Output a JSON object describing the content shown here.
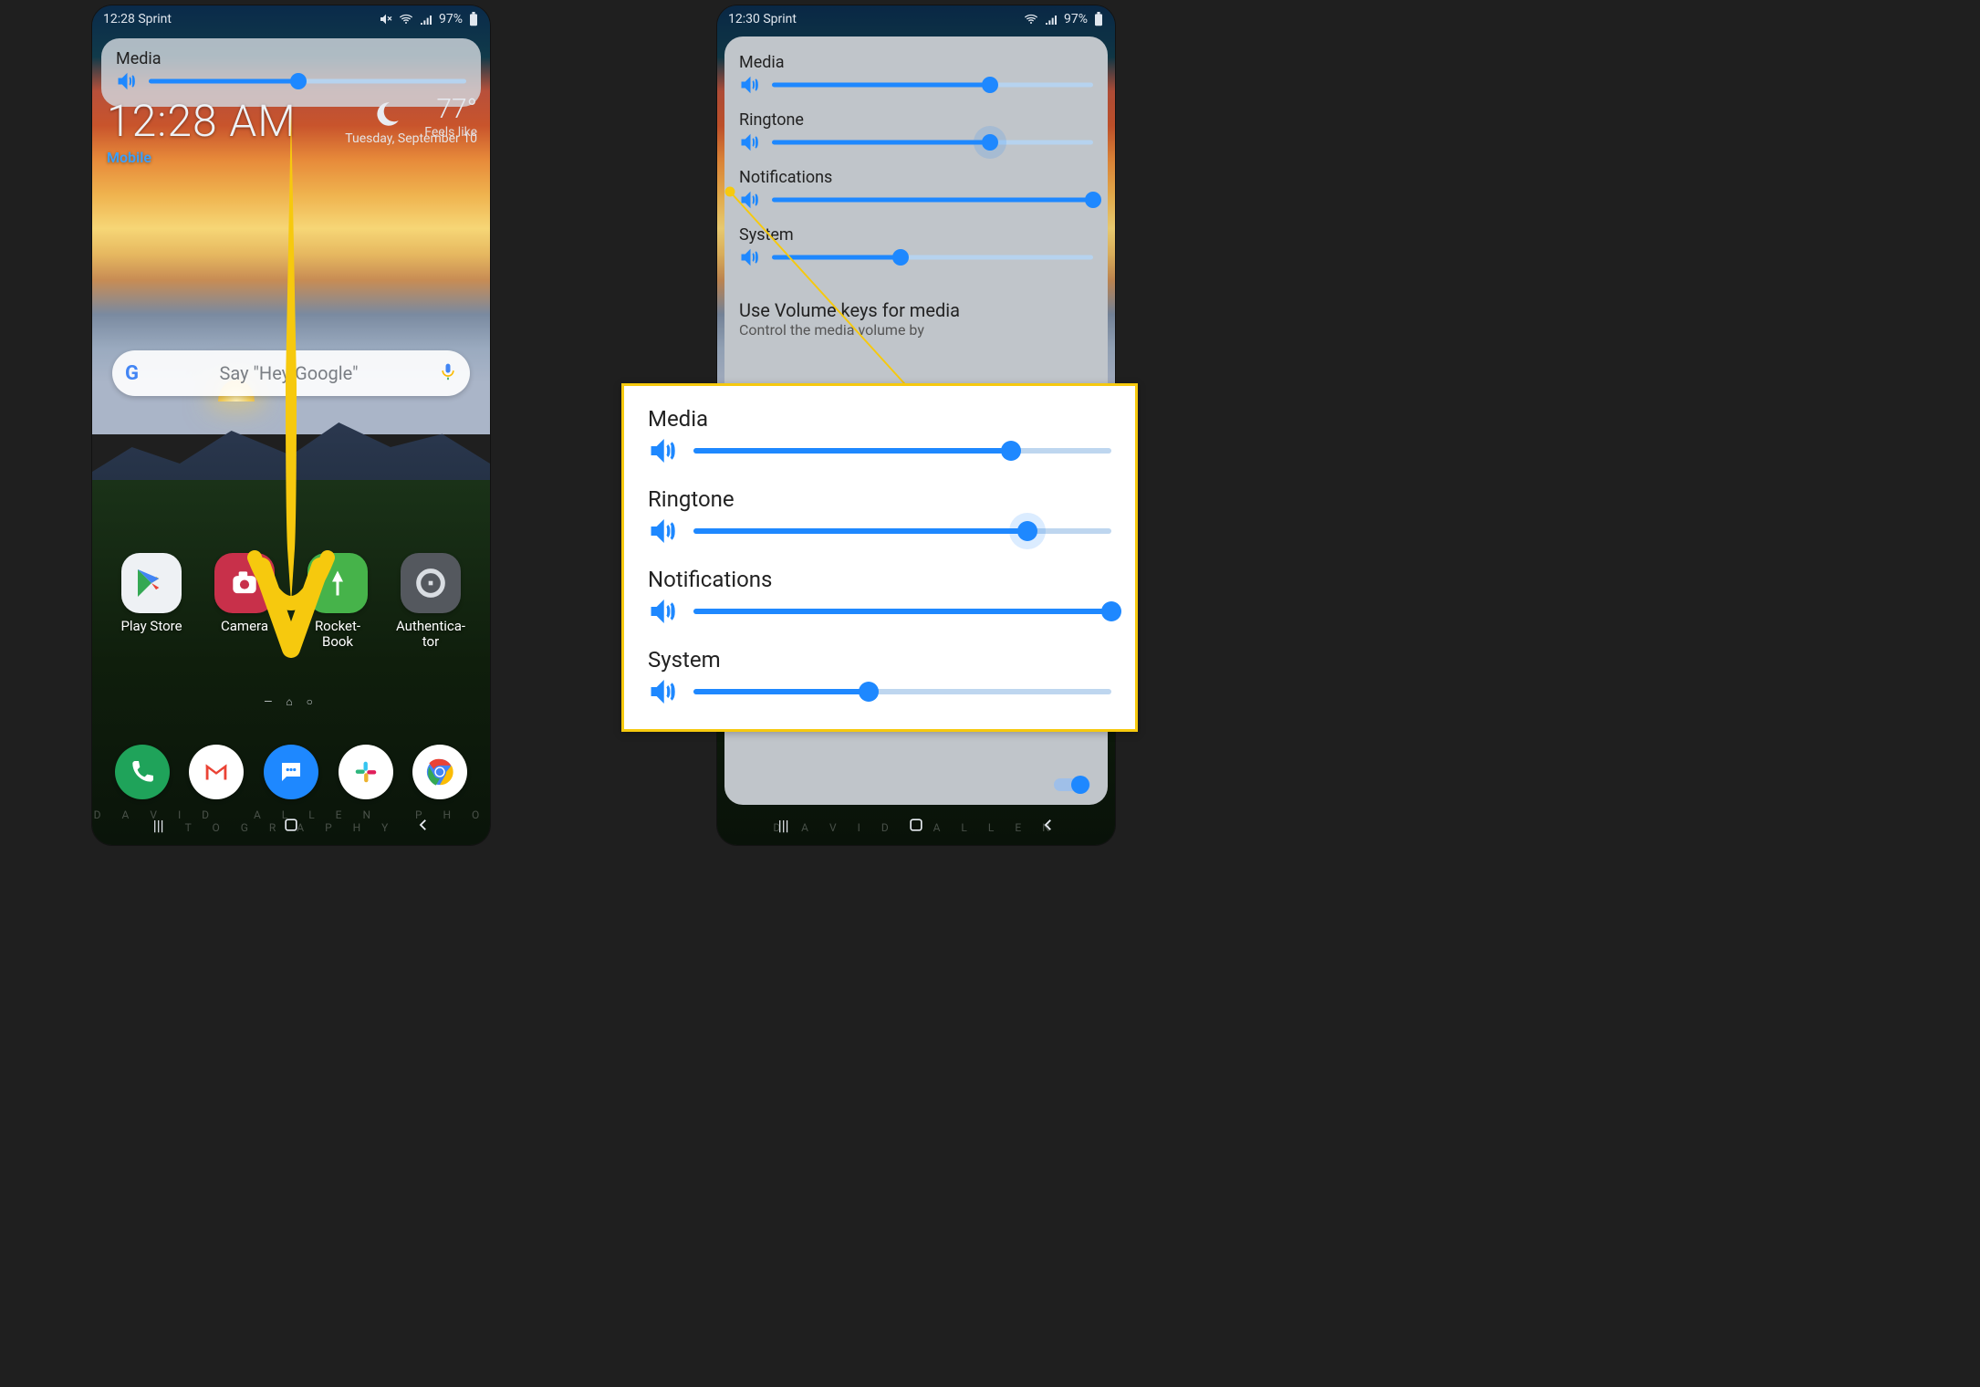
{
  "status_left": {
    "time": "12:28",
    "carrier": "Sprint",
    "battery": "97%"
  },
  "status_right": {
    "time": "12:30",
    "carrier": "Sprint",
    "battery": "97%"
  },
  "home": {
    "clock": "12:28 AM",
    "mobile": "Mobile",
    "date": "Tuesday, September 10",
    "temp": "77",
    "feels": "Feels like",
    "search_hint": "Say \"Hey Google\"",
    "apps": [
      {
        "label": "Play Store"
      },
      {
        "label": "Camera"
      },
      {
        "label": "Rocket-\nBook"
      },
      {
        "label": "Authentica-\ntor"
      }
    ]
  },
  "overlay": {
    "media_label": "Media",
    "media_pct": 47
  },
  "panel": {
    "items": [
      {
        "label": "Media",
        "pct": 68,
        "halo": false
      },
      {
        "label": "Ringtone",
        "pct": 68,
        "halo": true
      },
      {
        "label": "Notifications",
        "pct": 100,
        "halo": false
      },
      {
        "label": "System",
        "pct": 40,
        "halo": false
      }
    ],
    "option_title": "Use Volume keys for media",
    "option_sub": "Control the media volume by"
  },
  "zoom": {
    "items": [
      {
        "label": "Media",
        "pct": 76,
        "halo": false
      },
      {
        "label": "Ringtone",
        "pct": 80,
        "halo": true
      },
      {
        "label": "Notifications",
        "pct": 100,
        "halo": false
      },
      {
        "label": "System",
        "pct": 42,
        "halo": false
      }
    ]
  }
}
